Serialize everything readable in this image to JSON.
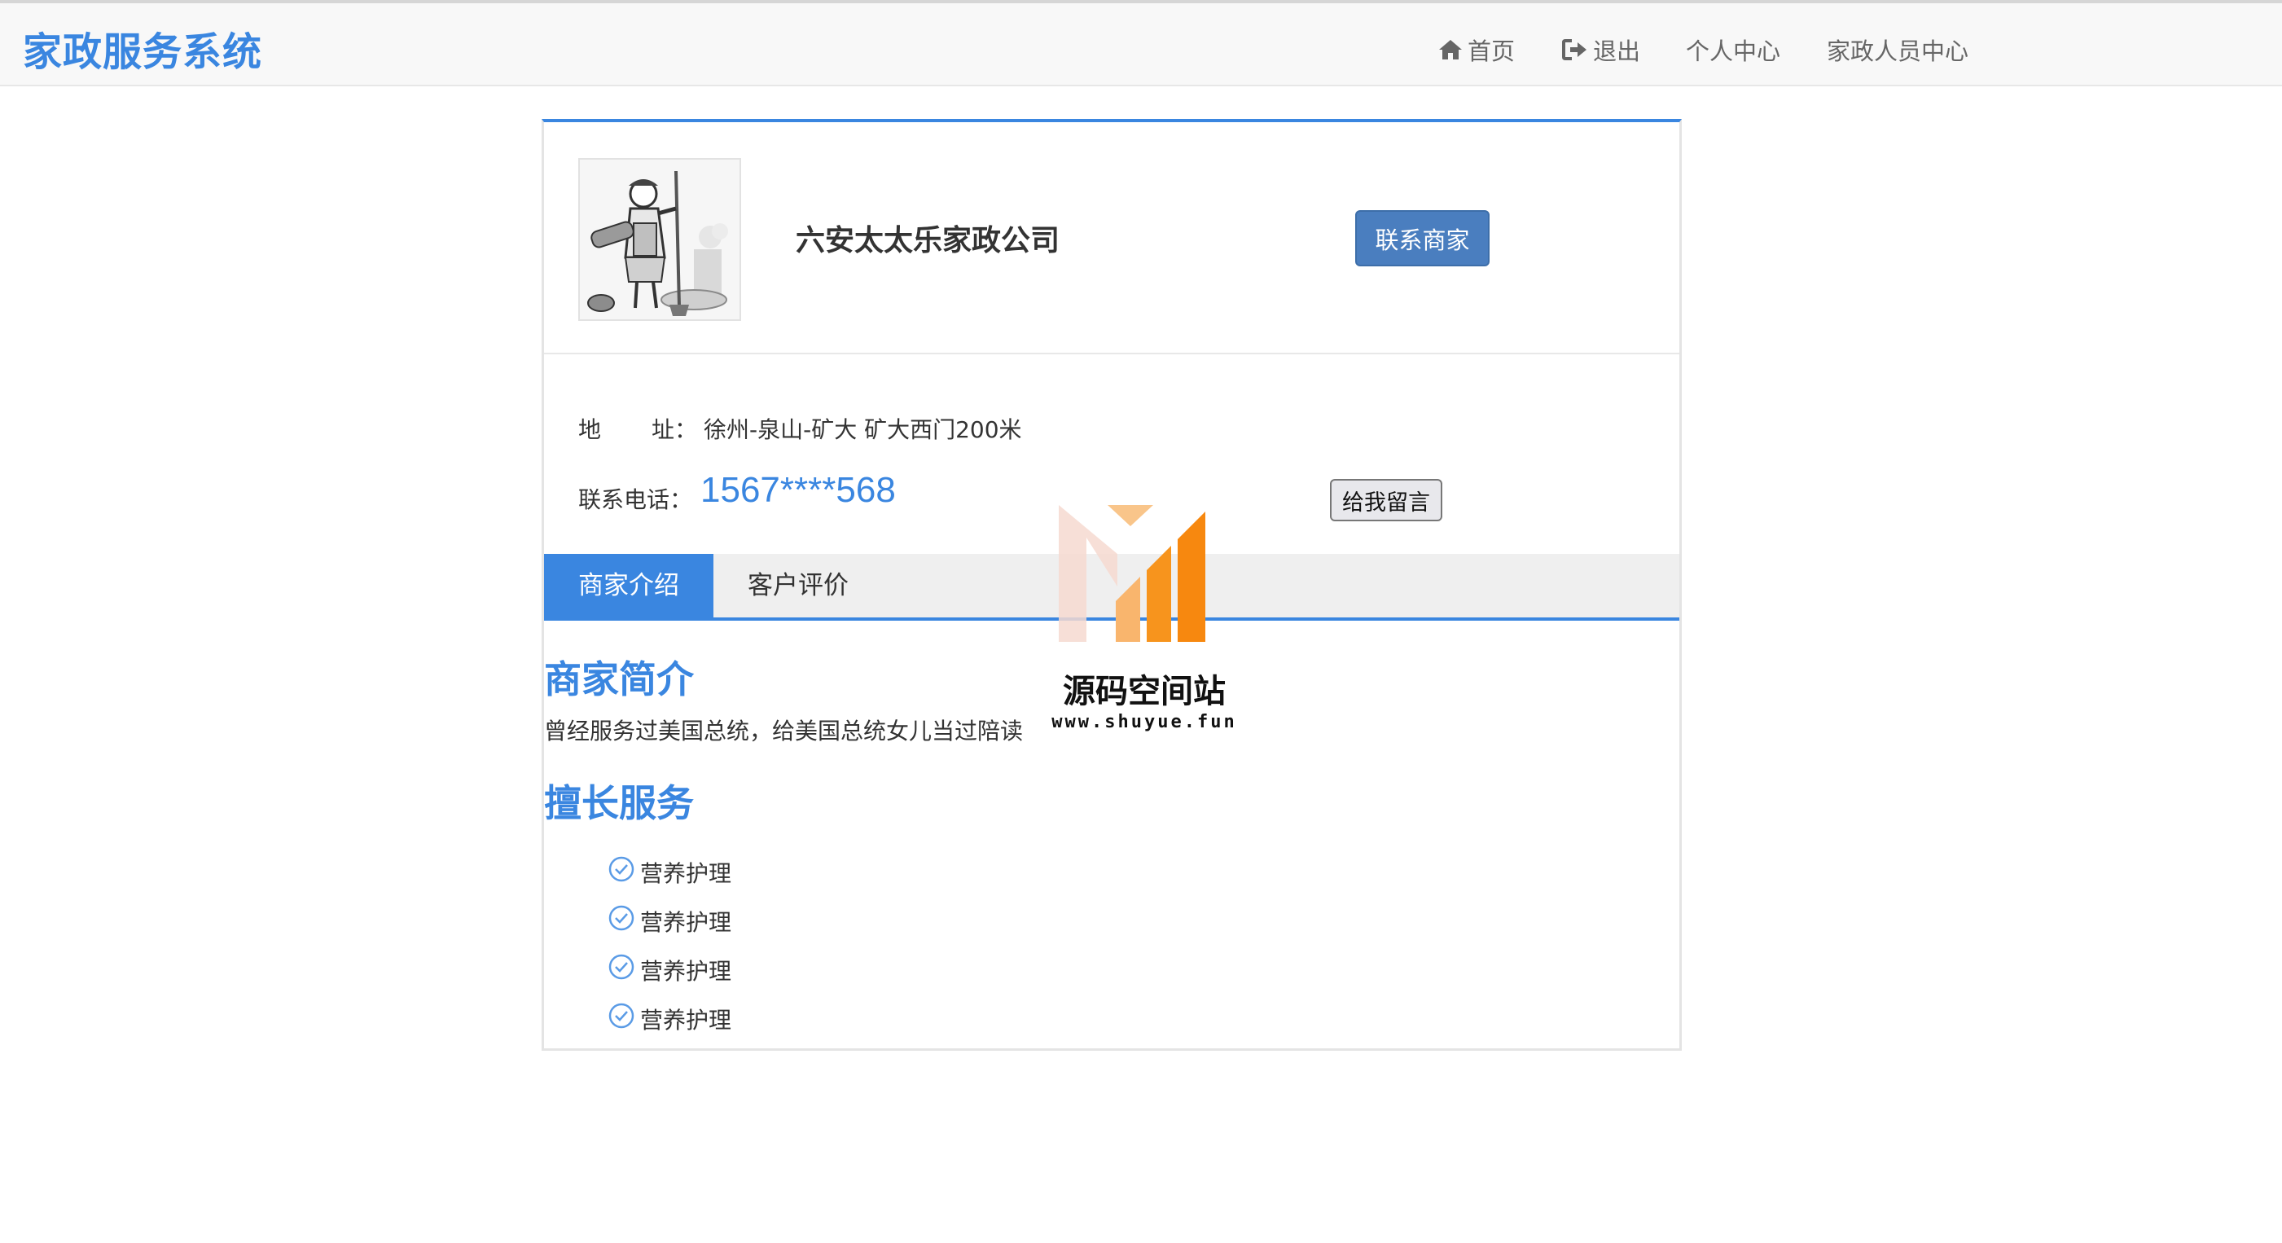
{
  "header": {
    "brand": "家政服务系统",
    "nav": {
      "home": "首页",
      "logout": "退出",
      "personal_center": "个人中心",
      "staff_center": "家政人员中心"
    }
  },
  "merchant": {
    "name": "六安太太乐家政公司",
    "contact_button": "联系商家",
    "address_label_1": "地",
    "address_label_2": "址：",
    "address": "徐州-泉山-矿大 矿大西门200米",
    "phone_label": "联系电话：",
    "phone": "1567****568",
    "message_button": "给我留言"
  },
  "tabs": [
    {
      "label": "商家介绍",
      "active": true
    },
    {
      "label": "客户评价",
      "active": false
    }
  ],
  "content": {
    "intro_title": "商家简介",
    "intro_text": "曾经服务过美国总统，给美国总统女儿当过陪读",
    "services_title": "擅长服务",
    "services": [
      "营养护理",
      "营养护理",
      "营养护理",
      "营养护理"
    ]
  },
  "watermark": {
    "title": "源码空间站",
    "url": "www.shuyue.fun"
  },
  "colors": {
    "accent": "#3a86e0",
    "button": "#4a7ebf",
    "nav_bg": "#f8f8f8",
    "watermark_orange": "#f7941d"
  },
  "icons": {
    "home": "home-icon",
    "logout": "sign-out-icon",
    "service_check": "check-circle-icon"
  }
}
